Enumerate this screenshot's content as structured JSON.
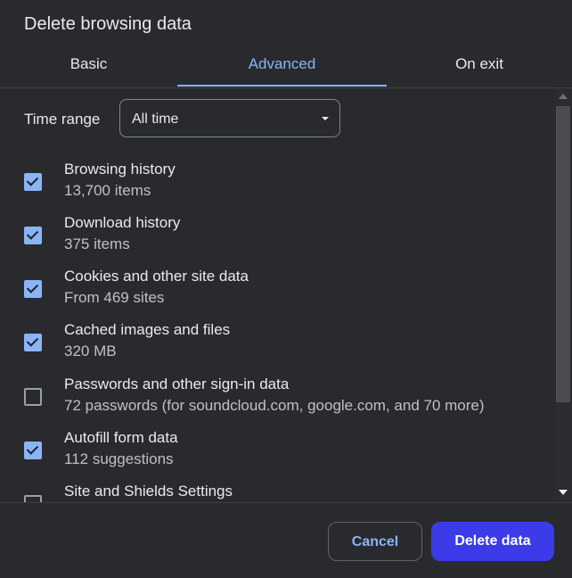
{
  "dialog": {
    "title": "Delete browsing data"
  },
  "tabs": [
    {
      "label": "Basic",
      "active": false
    },
    {
      "label": "Advanced",
      "active": true
    },
    {
      "label": "On exit",
      "active": false
    }
  ],
  "time_range": {
    "label": "Time range",
    "value": "All time"
  },
  "items": [
    {
      "title": "Browsing history",
      "subtitle": "13,700 items",
      "checked": true
    },
    {
      "title": "Download history",
      "subtitle": "375 items",
      "checked": true
    },
    {
      "title": "Cookies and other site data",
      "subtitle": "From 469 sites",
      "checked": true
    },
    {
      "title": "Cached images and files",
      "subtitle": "320 MB",
      "checked": true
    },
    {
      "title": "Passwords and other sign-in data",
      "subtitle": "72 passwords (for soundcloud.com, google.com, and 70 more)",
      "checked": false
    },
    {
      "title": "Autofill form data",
      "subtitle": "112 suggestions",
      "checked": true
    },
    {
      "title": "Site and Shields Settings",
      "subtitle": "",
      "checked": false
    }
  ],
  "buttons": {
    "cancel": "Cancel",
    "delete": "Delete data"
  },
  "colors": {
    "accent": "#8ab4f8",
    "primary_button": "#3b3be8",
    "background": "#292a2d"
  }
}
